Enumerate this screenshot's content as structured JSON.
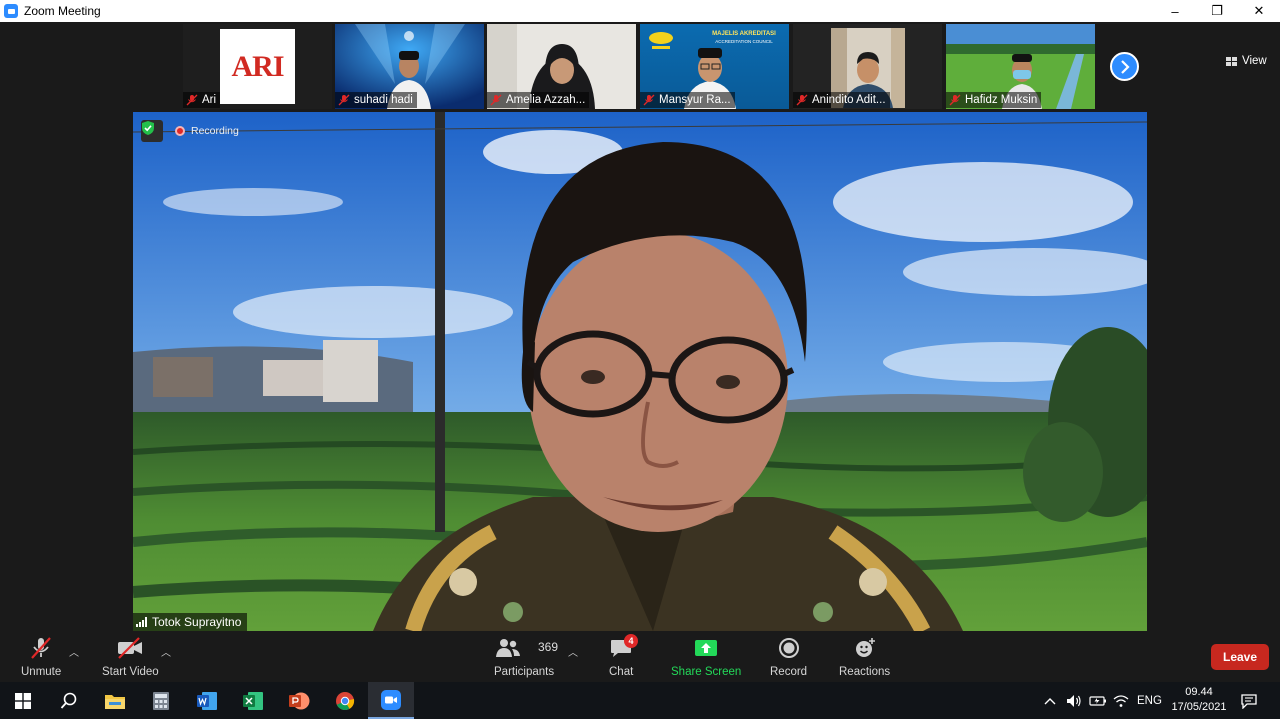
{
  "window": {
    "title": "Zoom Meeting",
    "controls": {
      "minimize": "–",
      "restore": "❐",
      "close": "✕"
    }
  },
  "thumbnails": [
    {
      "name": "Ari",
      "muted": true,
      "logo_text": "ARI"
    },
    {
      "name": "suhadi hadi",
      "muted": true
    },
    {
      "name": "Amelia Azzah...",
      "muted": true
    },
    {
      "name": "Mansyur Ra...",
      "muted": true,
      "banner_line1": "MAJELIS AKREDITASI",
      "banner_line2": "ACCREDITATION COUNCIL"
    },
    {
      "name": "Anindito Adit...",
      "muted": true
    },
    {
      "name": "Hafidz Muksin",
      "muted": true
    }
  ],
  "view_button": {
    "label": "View"
  },
  "next_page": {
    "icon": "chevron-right-icon"
  },
  "main_speaker": {
    "name": "Totok Suprayitno",
    "recording_label": "Recording"
  },
  "toolbar": {
    "unmute": "Unmute",
    "start_video": "Start Video",
    "participants": "Participants",
    "participants_count": "369",
    "chat": "Chat",
    "chat_badge": "4",
    "share_screen": "Share Screen",
    "record": "Record",
    "reactions": "Reactions",
    "leave": "Leave"
  },
  "taskbar": {
    "language": "ENG",
    "time": "09.44",
    "date": "17/05/2021"
  },
  "colors": {
    "zoom_blue": "#2d8cff",
    "leave_red": "#c7281f",
    "share_green": "#23d959",
    "mute_red": "#e02828"
  }
}
